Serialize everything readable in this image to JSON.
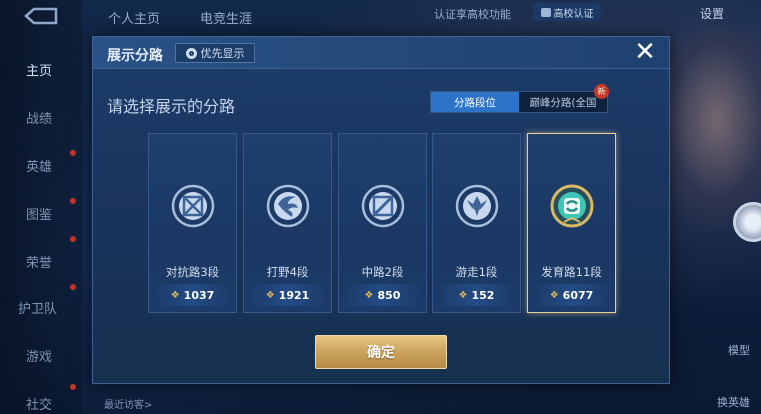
{
  "background": {
    "nav": {
      "back_icon": "back-arrow-icon",
      "items": [
        {
          "label": "主页",
          "active": true
        },
        {
          "label": "战绩",
          "active": false
        },
        {
          "label": "英雄",
          "active": false
        },
        {
          "label": "图鉴",
          "active": false
        },
        {
          "label": "荣誉",
          "active": false
        },
        {
          "label": "护卫队",
          "active": false
        },
        {
          "label": "游戏",
          "active": false
        },
        {
          "label": "社交",
          "active": false
        }
      ]
    },
    "top_tabs": [
      "个人主页",
      "电竞生涯"
    ],
    "campus_verify_text": "认证享高校功能",
    "campus_badge": "高校认证",
    "settings_label": "设置",
    "side_labels": {
      "model": "模型",
      "switch_hero": "换英雄"
    },
    "recent_visitors": "最近访客>"
  },
  "modal": {
    "title": "展示分路",
    "priority_button": "优先显示",
    "close_icon": "close-icon",
    "subtitle": "请选择展示的分路",
    "toggle": {
      "options": [
        {
          "label": "分路段位",
          "selected": true
        },
        {
          "label": "巅峰分路(全国",
          "selected": false,
          "badge": "新"
        }
      ]
    },
    "lanes": [
      {
        "label": "对抗路3段",
        "score": "1037",
        "icon": "clash-lane-icon",
        "selected": false
      },
      {
        "label": "打野4段",
        "score": "1921",
        "icon": "jungle-icon",
        "selected": false
      },
      {
        "label": "中路2段",
        "score": "850",
        "icon": "mid-lane-icon",
        "selected": false
      },
      {
        "label": "游走1段",
        "score": "152",
        "icon": "roam-icon",
        "selected": false
      },
      {
        "label": "发育路11段",
        "score": "6077",
        "icon": "farm-lane-icon",
        "selected": true
      }
    ],
    "confirm_button": "确定"
  },
  "colors": {
    "accent_blue": "#2d73c8",
    "gold": "#e8cf9a",
    "new_badge": "#c43a28"
  }
}
